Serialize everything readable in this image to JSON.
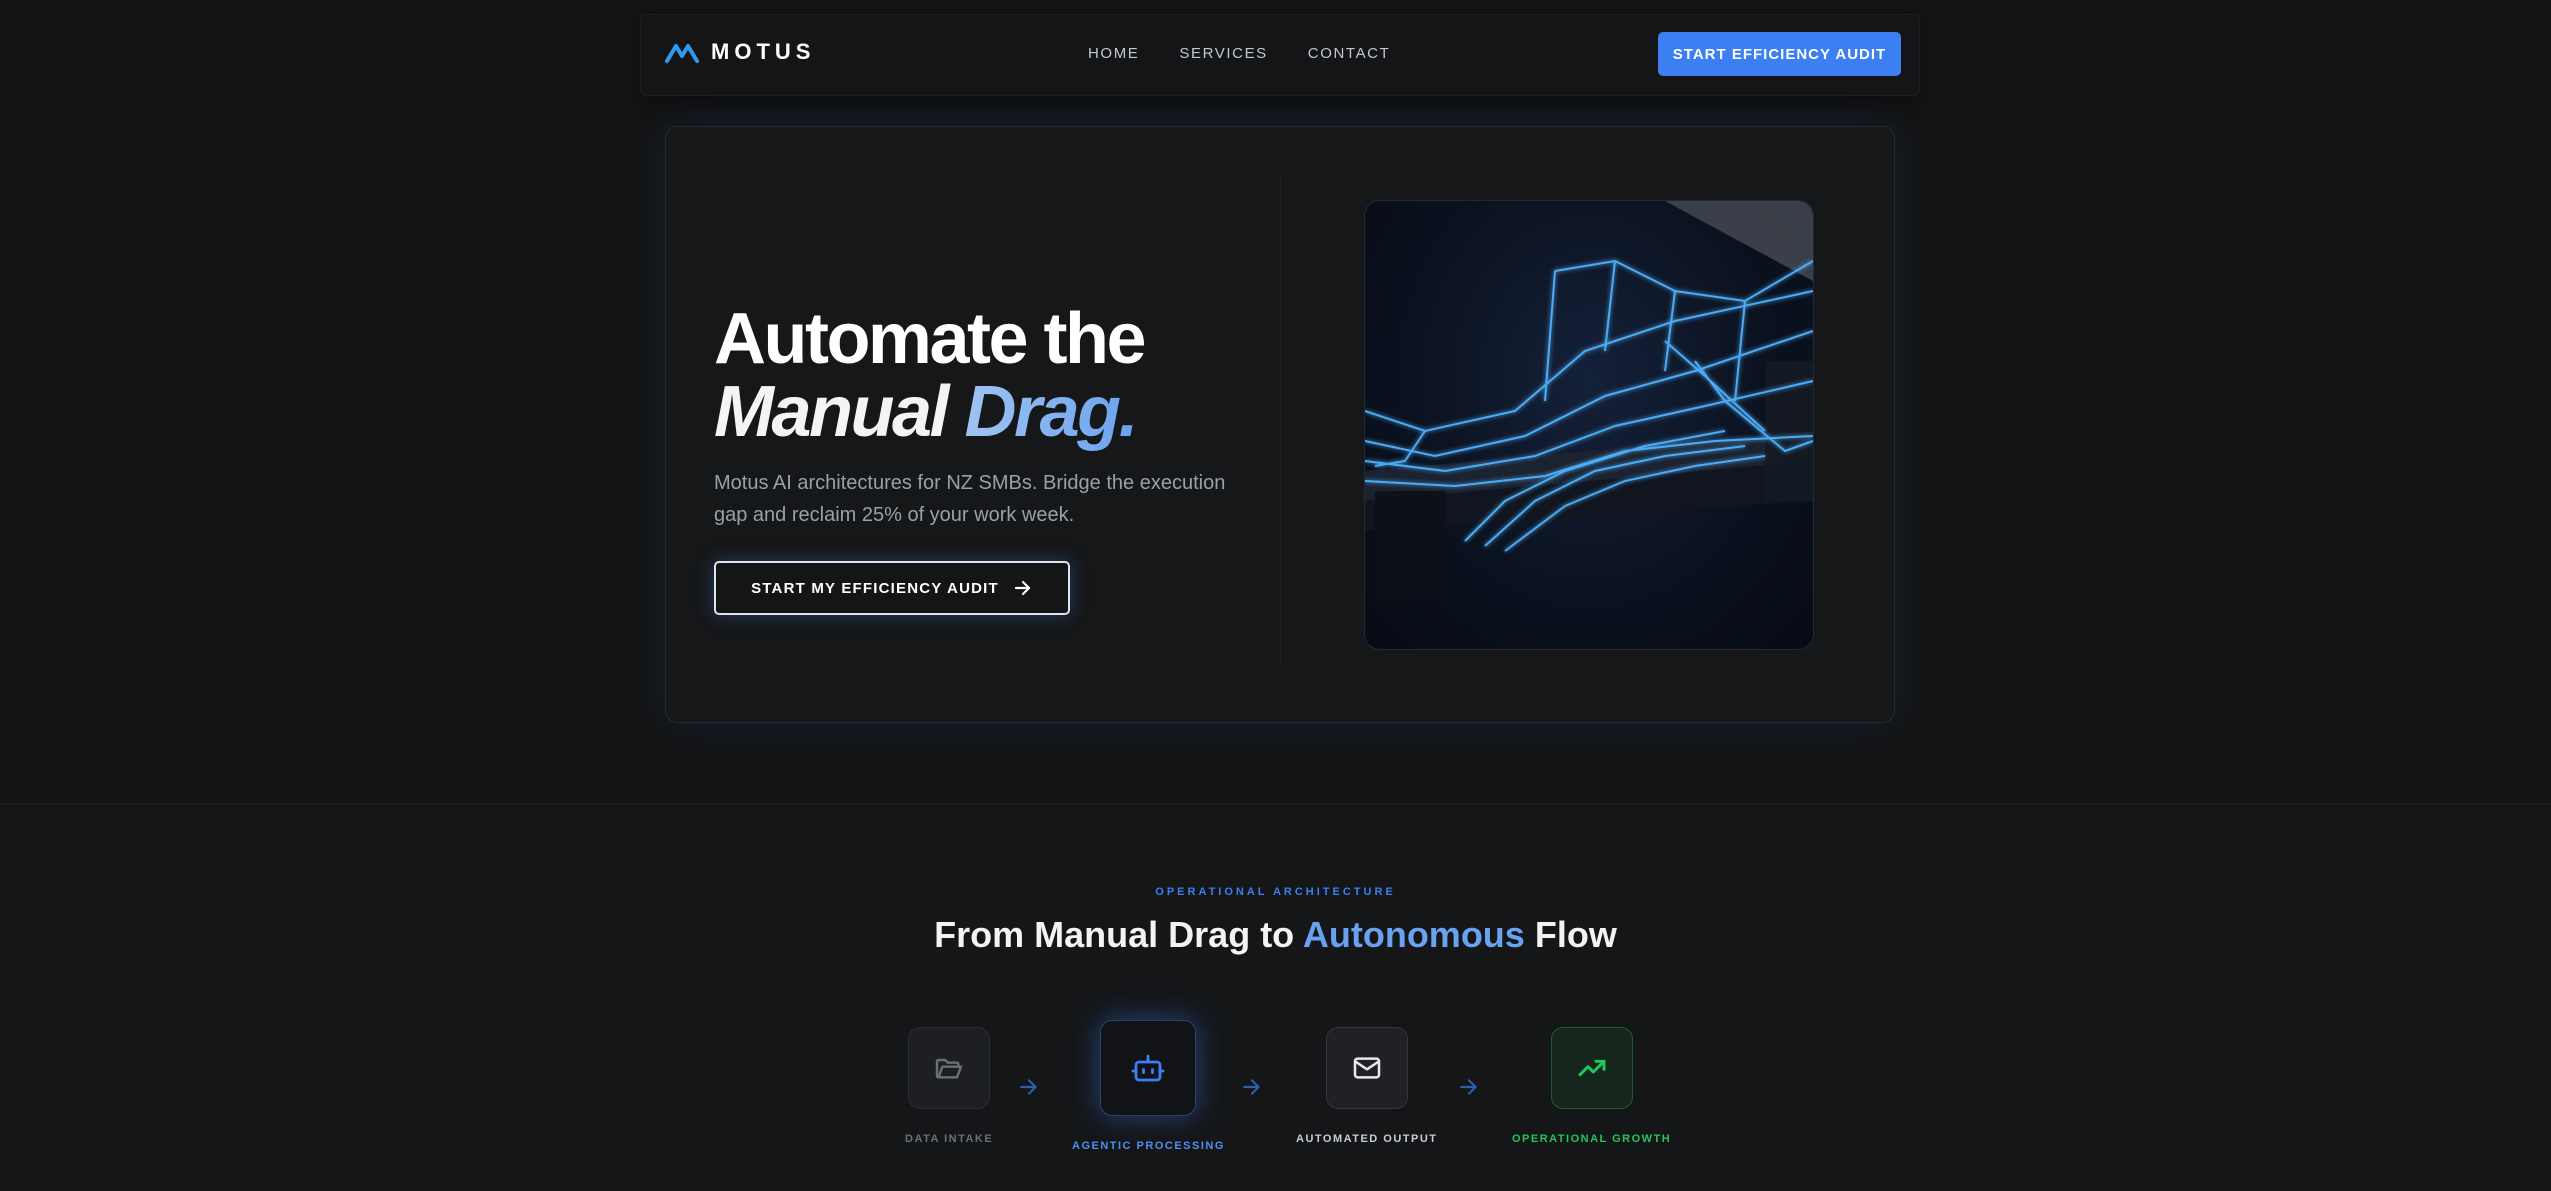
{
  "nav": {
    "brand": "MOTUS",
    "links": [
      "HOME",
      "SERVICES",
      "CONTACT"
    ],
    "cta_label": "START EFFICIENCY AUDIT"
  },
  "hero": {
    "headline_line1": "Automate the",
    "headline_line2_part1": "Manual",
    "headline_line2_part2": "Drag.",
    "subtext": "Motus AI architectures for NZ SMBs. Bridge the execution gap and reclaim 25% of your work week.",
    "button_label": "START MY EFFICIENCY AUDIT",
    "image_icon": "neon-wireframe-architecture-image"
  },
  "flow": {
    "eyebrow": "OPERATIONAL ARCHITECTURE",
    "title_part1": "From Manual Drag to",
    "title_accent": "Autonomous",
    "title_part2": "Flow",
    "steps": [
      {
        "label": "DATA INTAKE",
        "icon": "folder-open-icon",
        "color": "#6b6f76"
      },
      {
        "label": "AGENTIC PROCESSING",
        "icon": "robot-icon",
        "color": "#3b7ff2"
      },
      {
        "label": "AUTOMATED OUTPUT",
        "icon": "mail-icon",
        "color": "#d6d9de"
      },
      {
        "label": "OPERATIONAL GROWTH",
        "icon": "trending-up-icon",
        "color": "#22c55e"
      }
    ]
  },
  "colors": {
    "accent": "#3b7ff2",
    "background": "#131415",
    "growth": "#22c55e"
  }
}
